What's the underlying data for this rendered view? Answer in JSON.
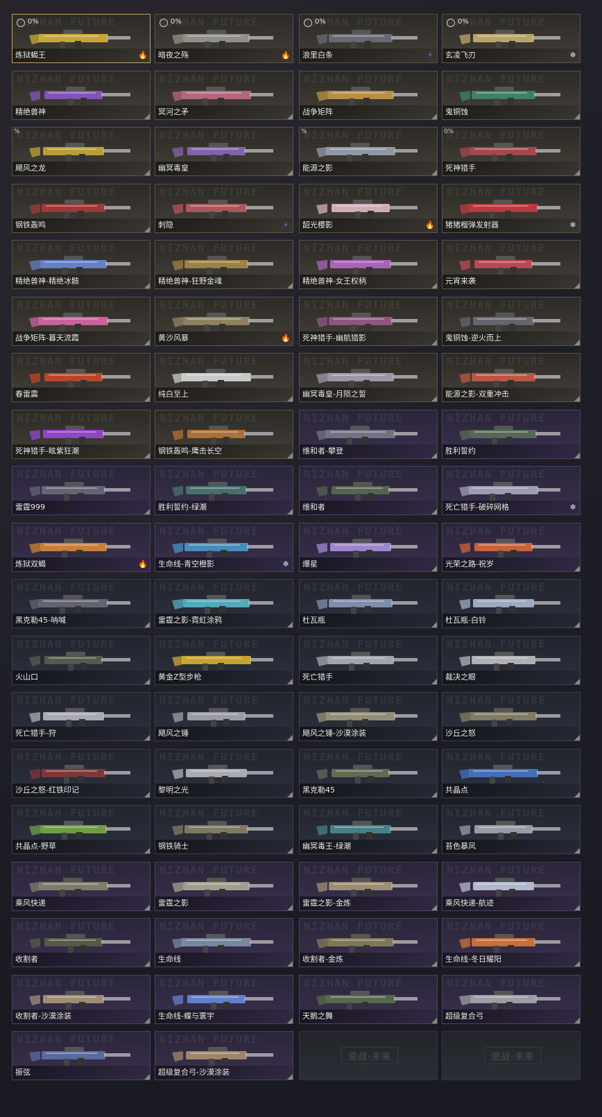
{
  "watermark": "NIZHAN FUTURE",
  "empty_logo": "逆战·未来",
  "items": [
    {
      "name": "炼狱蝎王",
      "pct": "0%",
      "tier": "gold",
      "badge": "fire",
      "selected": true,
      "radio": true,
      "accent": "#d6b23a"
    },
    {
      "name": "暗夜之殇",
      "pct": "0%",
      "tier": "gold",
      "badge": "fire",
      "radio": true,
      "accent": "#9a9a92"
    },
    {
      "name": "浪里白条",
      "pct": "0%",
      "tier": "gold",
      "badge": "bolt",
      "radio": true,
      "accent": "#6e6e78"
    },
    {
      "name": "玄凌飞刃",
      "pct": "0%",
      "tier": "gold",
      "badge": "snow",
      "radio": true,
      "accent": "#c8b070"
    },
    {
      "name": "精绝兽神",
      "tier": "gold",
      "accent": "#8a58c8"
    },
    {
      "name": "冥河之矛",
      "tier": "gold",
      "accent": "#c26c88"
    },
    {
      "name": "战争矩阵",
      "tier": "gold",
      "accent": "#c89848"
    },
    {
      "name": "鬼铜蚀",
      "tier": "gold",
      "accent": "#3f8a6a"
    },
    {
      "name": "飓风之龙",
      "pct": "%",
      "tier": "gold",
      "accent": "#c8a838"
    },
    {
      "name": "幽冥毒皇",
      "tier": "gold",
      "accent": "#8a68b8"
    },
    {
      "name": "能源之影",
      "pct": "%",
      "tier": "gold",
      "accent": "#9aa2b4"
    },
    {
      "name": "死神猎手",
      "pct": "0%",
      "tier": "gold",
      "accent": "#b04a52"
    },
    {
      "name": "钢铁轰鸣",
      "tier": "gold",
      "accent": "#a83a3a"
    },
    {
      "name": "刺隐",
      "tier": "gold",
      "badge": "bolt",
      "accent": "#b85a60"
    },
    {
      "name": "韶光樱影",
      "tier": "gold",
      "badge": "fire",
      "accent": "#e2b8c8"
    },
    {
      "name": "猪猪榴弹发射器",
      "tier": "gold",
      "badge": "snow",
      "accent": "#c83a42"
    },
    {
      "name": "精绝兽神-精绝冰骸",
      "tier": "gold",
      "accent": "#6a88d8"
    },
    {
      "name": "精绝兽神-狂野金魂",
      "tier": "gold",
      "accent": "#a88a4a"
    },
    {
      "name": "精绝兽神-女王权柄",
      "tier": "gold",
      "accent": "#b868c8"
    },
    {
      "name": "元宵来袭",
      "tier": "gold",
      "accent": "#c84a5a"
    },
    {
      "name": "战争矩阵-暮天流霞",
      "tier": "gold",
      "accent": "#d868a8"
    },
    {
      "name": "黄沙风暴",
      "tier": "gold",
      "badge": "fire",
      "accent": "#9a8a68"
    },
    {
      "name": "死神猎手-幽航猎影",
      "tier": "gold",
      "accent": "#985a8a"
    },
    {
      "name": "鬼铜蚀-逆火而上",
      "tier": "gold",
      "accent": "#6a6a78"
    },
    {
      "name": "春雷震",
      "tier": "gold",
      "accent": "#c8482a"
    },
    {
      "name": "纯白至上",
      "tier": "gold",
      "accent": "#d8d8dc"
    },
    {
      "name": "幽冥毒皇-月陨之誓",
      "tier": "gold",
      "accent": "#a8a0b8"
    },
    {
      "name": "能源之影-双重冲击",
      "tier": "gold",
      "accent": "#c85a48"
    },
    {
      "name": "死神猎手-眩紫狂潮",
      "tier": "gold",
      "accent": "#9848d8"
    },
    {
      "name": "钢铁轰鸣-鹰击长空",
      "tier": "gold",
      "accent": "#b87838"
    },
    {
      "name": "维和者-攀登",
      "tier": "purple",
      "accent": "#7a7a88"
    },
    {
      "name": "胜利誓约",
      "tier": "purple",
      "accent": "#5a7058"
    },
    {
      "name": "雷霆999",
      "tier": "purple",
      "accent": "#6a6a78"
    },
    {
      "name": "胜利誓约-绿潮",
      "tier": "purple",
      "accent": "#4a7870"
    },
    {
      "name": "维和者",
      "tier": "purple",
      "accent": "#5a6a50"
    },
    {
      "name": "死亡猎手-破碎网格",
      "tier": "purple",
      "badge": "snow",
      "accent": "#a8a8c0"
    },
    {
      "name": "炼狱双蝎",
      "tier": "purple",
      "badge": "fire",
      "accent": "#d88838"
    },
    {
      "name": "生命线-青空橙影",
      "tier": "purple",
      "badge": "snow",
      "accent": "#4a98c8"
    },
    {
      "name": "爆星",
      "tier": "purple",
      "accent": "#a890d8"
    },
    {
      "name": "光荣之路-祝岁",
      "tier": "purple",
      "accent": "#d86838"
    },
    {
      "name": "黑克勒45-呐喊",
      "tier": "blue",
      "accent": "#6a6a78"
    },
    {
      "name": "雷霆之影-霓虹涂鸦",
      "tier": "blue",
      "accent": "#58b8c8"
    },
    {
      "name": "杜瓦瓶",
      "tier": "blue",
      "accent": "#8898b8"
    },
    {
      "name": "杜瓦瓶-白铃",
      "tier": "blue",
      "accent": "#a8b8d0"
    },
    {
      "name": "火山口",
      "tier": "blue",
      "accent": "#5a6050"
    },
    {
      "name": "黄金Z型步枪",
      "tier": "blue",
      "accent": "#d8b030"
    },
    {
      "name": "死亡猎手",
      "tier": "blue",
      "accent": "#b0b0b8"
    },
    {
      "name": "裁决之眼",
      "tier": "blue",
      "accent": "#c0c0c4"
    },
    {
      "name": "死亡猎手-狩",
      "tier": "blue",
      "accent": "#b8b8c0"
    },
    {
      "name": "飓风之锤",
      "tier": "blue",
      "accent": "#a8a8b0"
    },
    {
      "name": "飓风之锤-沙漠涂装",
      "tier": "blue",
      "accent": "#a09880"
    },
    {
      "name": "沙丘之怒",
      "tier": "blue",
      "accent": "#8a8468"
    },
    {
      "name": "沙丘之怒-红铁印记",
      "tier": "blue",
      "accent": "#883838"
    },
    {
      "name": "黎明之光",
      "tier": "blue",
      "accent": "#b8b8c0"
    },
    {
      "name": "黑克勒45",
      "tier": "blue",
      "accent": "#6a7058"
    },
    {
      "name": "共晶点",
      "tier": "blue",
      "accent": "#4878c8"
    },
    {
      "name": "共晶点-野草",
      "tier": "blue",
      "accent": "#78a848"
    },
    {
      "name": "钢铁骑士",
      "tier": "blue",
      "accent": "#8a8068"
    },
    {
      "name": "幽冥毒王-绿潮",
      "tier": "blue",
      "accent": "#4a8890"
    },
    {
      "name": "苔色暴风",
      "tier": "blue",
      "accent": "#a0a8b0"
    },
    {
      "name": "乘风快递",
      "tier": "purple",
      "accent": "#8a8470"
    },
    {
      "name": "雷霆之影",
      "tier": "purple",
      "accent": "#b0a898"
    },
    {
      "name": "雷霆之影-金炼",
      "tier": "purple",
      "accent": "#a89878"
    },
    {
      "name": "乘风快递-航迹",
      "tier": "purple",
      "accent": "#c0c8d8"
    },
    {
      "name": "收割者",
      "tier": "purple",
      "accent": "#5a6048"
    },
    {
      "name": "生命线",
      "tier": "purple",
      "accent": "#8090a8"
    },
    {
      "name": "收割者-金炼",
      "tier": "purple",
      "accent": "#8a8058"
    },
    {
      "name": "生命线-冬日耀阳",
      "tier": "purple",
      "accent": "#d87838"
    },
    {
      "name": "收割者-沙漠涂装",
      "tier": "purple",
      "accent": "#a89878"
    },
    {
      "name": "生命线-蝶与寰宇",
      "tier": "purple",
      "accent": "#6888d8"
    },
    {
      "name": "天鹅之舞",
      "tier": "purple",
      "accent": "#5a7050"
    },
    {
      "name": "超级复合弓",
      "tier": "purple",
      "accent": "#a8a8b0"
    },
    {
      "name": "振弦",
      "tier": "purple",
      "accent": "#6070a8"
    },
    {
      "name": "超级复合弓-沙漠涂装",
      "tier": "purple",
      "accent": "#a89070"
    },
    {
      "name": "",
      "tier": "empty"
    },
    {
      "name": "",
      "tier": "empty"
    }
  ]
}
